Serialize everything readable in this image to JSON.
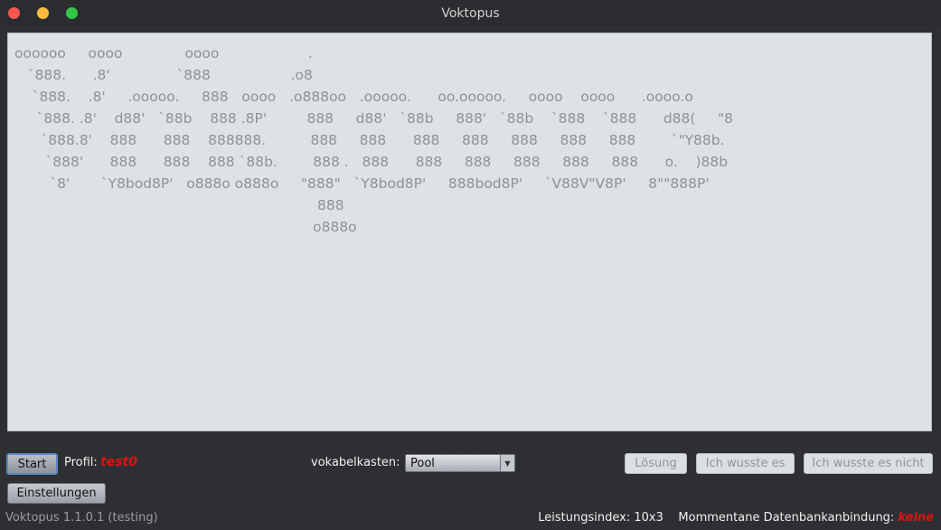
{
  "window": {
    "title": "Voktopus"
  },
  "display": {
    "ascii_art": "oooooo     oooo              oooo                    .\n   `888.      .8'               `888                  .o8\n    `888.    .8'     .ooooo.     888   oooo   .o888oo   .ooooo.      oo.ooooo.     oooo    oooo      .oooo.o\n     `888. .8'    d88'   `88b    888 .8P'         888     d88'   `88b     888'   `88b    `888    `888      d88(     \"8\n      `888.8'    888      888    888888.          888     888      888     888     888     888     888        `\"Y88b.\n       `888'      888      888    888 `88b.        888 .   888      888     888     888     888     888      o.    )88b\n        `8'       `Y8bod8P'   o888o o888o     \"888\"   `Y8bod8P'     888bod8P'     `V88V\"V8P'     8\"\"888P'\n                                                                    888\n                                                                   o888o"
  },
  "controls": {
    "start_label": "Start",
    "profile_label": "Profil:",
    "profile_value": "test0",
    "box_label": "vokabelkasten:",
    "box_selected": "Pool",
    "solution_label": "Lösung",
    "knew_label": "Ich wusste es",
    "knew_not_label": "Ich wusste es nicht",
    "settings_label": "Einstellungen"
  },
  "footer": {
    "version": "Voktopus 1.1.0.1 (testing)",
    "performance_label": "Leistungsindex: 10x3",
    "db_label": "Mommentane Datenbankanbindung:",
    "db_value": "keine"
  },
  "colors": {
    "background": "#2e2f32",
    "display_bg": "#dfe2e5",
    "accent_red": "#e01212",
    "close": "#fc5753",
    "minimize": "#fdbc40",
    "maximize": "#33c748"
  }
}
